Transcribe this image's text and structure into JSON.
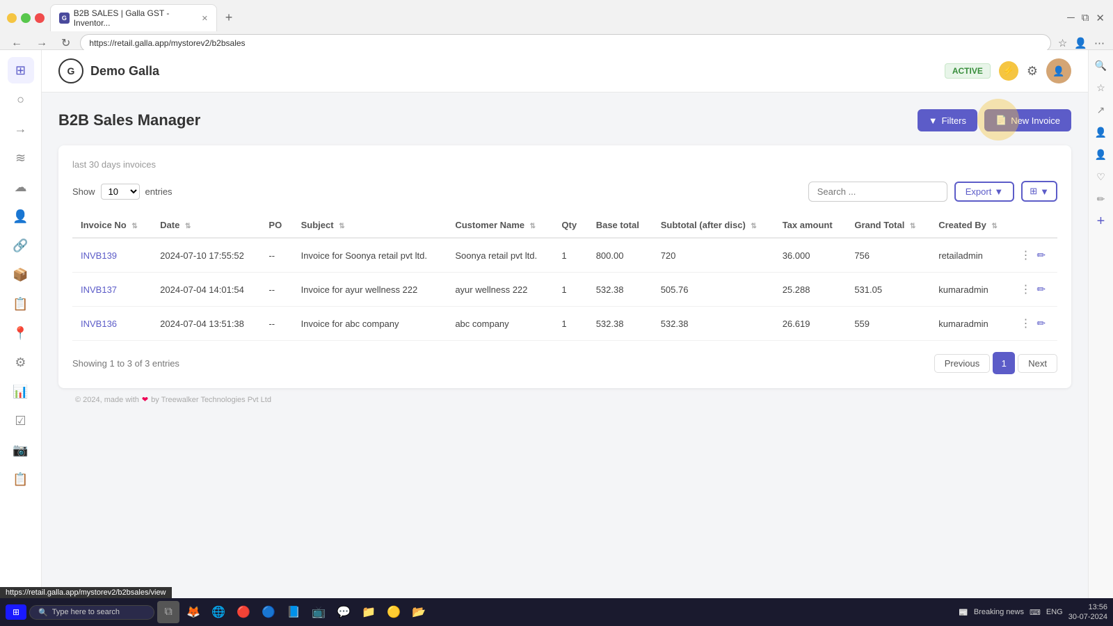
{
  "browser": {
    "tab_title": "B2B SALES | Galla GST - Inventor...",
    "tab_favicon": "G",
    "url": "https://retail.galla.app/mystorev2/b2bsales",
    "url_tooltip": "https://retail.galla.app/mystorev2/b2bsales/view"
  },
  "header": {
    "logo_text": "Galla",
    "brand_name": "Demo Galla",
    "active_badge": "ACTIVE",
    "filters_btn": "Filters",
    "new_invoice_btn": "New Invoice"
  },
  "page": {
    "title": "B2B Sales Manager",
    "subheading": "last 30 days invoices",
    "show_label": "Show",
    "entries_value": "10",
    "entries_label": "entries",
    "search_placeholder": "Search ...",
    "export_btn": "Export",
    "showing_info": "Showing 1 to 3 of 3 entries"
  },
  "table": {
    "columns": [
      "Invoice No",
      "Date",
      "PO",
      "Subject",
      "Customer Name",
      "Qty",
      "Base total",
      "Subtotal (after disc)",
      "Tax amount",
      "Grand Total",
      "Created By",
      ""
    ],
    "rows": [
      {
        "invoice_no": "INVB139",
        "date": "2024-07-10 17:55:52",
        "po": "--",
        "subject": "Invoice for Soonya retail pvt ltd.",
        "customer_name": "Soonya retail pvt ltd.",
        "qty": "1",
        "base_total": "800.00",
        "subtotal": "720",
        "tax_amount": "36.000",
        "grand_total": "756",
        "created_by": "retailadmin"
      },
      {
        "invoice_no": "INVB137",
        "date": "2024-07-04 14:01:54",
        "po": "--",
        "subject": "Invoice for ayur wellness 222",
        "customer_name": "ayur wellness 222",
        "qty": "1",
        "base_total": "532.38",
        "subtotal": "505.76",
        "tax_amount": "25.288",
        "grand_total": "531.05",
        "created_by": "kumaradmin"
      },
      {
        "invoice_no": "INVB136",
        "date": "2024-07-04 13:51:38",
        "po": "--",
        "subject": "Invoice for abc company",
        "customer_name": "abc company",
        "qty": "1",
        "base_total": "532.38",
        "subtotal": "532.38",
        "tax_amount": "26.619",
        "grand_total": "559",
        "created_by": "kumaradmin"
      }
    ]
  },
  "pagination": {
    "prev_label": "Previous",
    "page_number": "1",
    "next_label": "Next"
  },
  "footer": {
    "text": "© 2024, made with",
    "by_text": "by Treewalker Technologies Pvt Ltd"
  },
  "sidebar": {
    "icons": [
      "⊞",
      "○",
      "→",
      "≋",
      "☁",
      "👤",
      "🔗",
      "📦",
      "📋",
      "📍",
      "⚙",
      "📊",
      "☑",
      "📷",
      "📋"
    ]
  },
  "taskbar": {
    "search_placeholder": "Type here to search",
    "time": "13:56",
    "date": "30-07-2024",
    "lang": "ENG",
    "news": "Breaking news"
  }
}
